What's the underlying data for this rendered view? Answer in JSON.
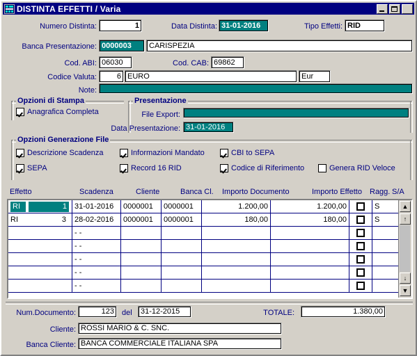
{
  "window": {
    "title": "DISTINTA EFFETTI / Varia",
    "icon": "distinta-app-icon",
    "minimize_label": "",
    "maximize_label": "",
    "close_label": ""
  },
  "colors": {
    "titlebar": "#000080",
    "label_text": "#000080",
    "selection_teal": "#008080",
    "window_face": "#d4d0c8",
    "grid_line": "#000080"
  },
  "header_fields": {
    "numero_distinta_label": "Numero Distinta:",
    "numero_distinta_value": "1",
    "data_distinta_label": "Data Distinta:",
    "data_distinta_value": "31-01-2016",
    "tipo_effetti_label": "Tipo Effetti:",
    "tipo_effetti_value": "RID",
    "banca_presentazione_label": "Banca Presentazione:",
    "banca_presentazione_code": "0000003",
    "banca_presentazione_name": "CARISPEZIA",
    "cod_abi_label": "Cod. ABI:",
    "cod_abi_value": "06030",
    "cod_cab_label": "Cod. CAB:",
    "cod_cab_value": "69862",
    "codice_valuta_label": "Codice Valuta:",
    "codice_valuta_code": "6",
    "codice_valuta_name": "EURO",
    "codice_valuta_short": "Eur",
    "note_label": "Note:",
    "note_value": ""
  },
  "opzioni_stampa": {
    "title": "Opzioni di Stampa",
    "items": [
      {
        "label": "Anagrafica Completa",
        "checked": true
      }
    ]
  },
  "presentazione": {
    "title": "Presentazione",
    "file_export_label": "File Export:",
    "file_export_value": "",
    "data_presentazione_label": "Data Presentazione:",
    "data_presentazione_value": "31-01-2016"
  },
  "opzioni_generazione": {
    "title": "Opzioni Generazione File",
    "items": [
      {
        "label": "Descrizione Scadenza",
        "checked": true
      },
      {
        "label": "Informazioni Mandato",
        "checked": true
      },
      {
        "label": "CBI to SEPA",
        "checked": true
      },
      {
        "label": "SEPA",
        "checked": true
      },
      {
        "label": "Record 16 RID",
        "checked": true
      },
      {
        "label": "Codice di Riferimento",
        "checked": true
      },
      {
        "label": "Genera RID Veloce",
        "checked": false
      }
    ]
  },
  "grid": {
    "columns": [
      "Effetto",
      "Scadenza",
      "Cliente",
      "Banca Cl.",
      "Importo Documento",
      "Importo Effetto",
      "Ragg.",
      "S/A"
    ],
    "rows": [
      {
        "selected": true,
        "tipo": "RI",
        "numero": "1",
        "scadenza": "31-01-2016",
        "cliente": "0000001",
        "banca_cliente": "0000001",
        "importo_documento": "1.200,00",
        "importo_effetto": "1.200,00",
        "ragg": false,
        "sa": "S"
      },
      {
        "selected": false,
        "tipo": "RI",
        "numero": "3",
        "scadenza": "28-02-2016",
        "cliente": "0000001",
        "banca_cliente": "0000001",
        "importo_documento": "180,00",
        "importo_effetto": "180,00",
        "ragg": false,
        "sa": "S"
      },
      {
        "selected": false,
        "tipo": "",
        "numero": "",
        "scadenza": "- -",
        "cliente": "",
        "banca_cliente": "",
        "importo_documento": "",
        "importo_effetto": "",
        "ragg": false,
        "sa": ""
      },
      {
        "selected": false,
        "tipo": "",
        "numero": "",
        "scadenza": "- -",
        "cliente": "",
        "banca_cliente": "",
        "importo_documento": "",
        "importo_effetto": "",
        "ragg": false,
        "sa": ""
      },
      {
        "selected": false,
        "tipo": "",
        "numero": "",
        "scadenza": "- -",
        "cliente": "",
        "banca_cliente": "",
        "importo_documento": "",
        "importo_effetto": "",
        "ragg": false,
        "sa": ""
      },
      {
        "selected": false,
        "tipo": "",
        "numero": "",
        "scadenza": "- -",
        "cliente": "",
        "banca_cliente": "",
        "importo_documento": "",
        "importo_effetto": "",
        "ragg": false,
        "sa": ""
      },
      {
        "selected": false,
        "tipo": "",
        "numero": "",
        "scadenza": "- -",
        "cliente": "",
        "banca_cliente": "",
        "importo_documento": "",
        "importo_effetto": "",
        "ragg": false,
        "sa": ""
      }
    ],
    "scrollbar": {
      "top_button": "▲",
      "up_button": "↑",
      "down_button": "↓",
      "bottom_button": "▼"
    }
  },
  "footer": {
    "num_documento_label": "Num.Documento:",
    "num_documento_value": "123",
    "del_label": "del",
    "data_documento_value": "31-12-2015",
    "totale_label": "TOTALE:",
    "totale_value": "1.380,00",
    "cliente_label": "Cliente:",
    "cliente_value": "ROSSI MARIO & C. SNC.",
    "banca_cliente_label": "Banca Cliente:",
    "banca_cliente_value": "BANCA COMMERCIALE ITALIANA SPA"
  }
}
